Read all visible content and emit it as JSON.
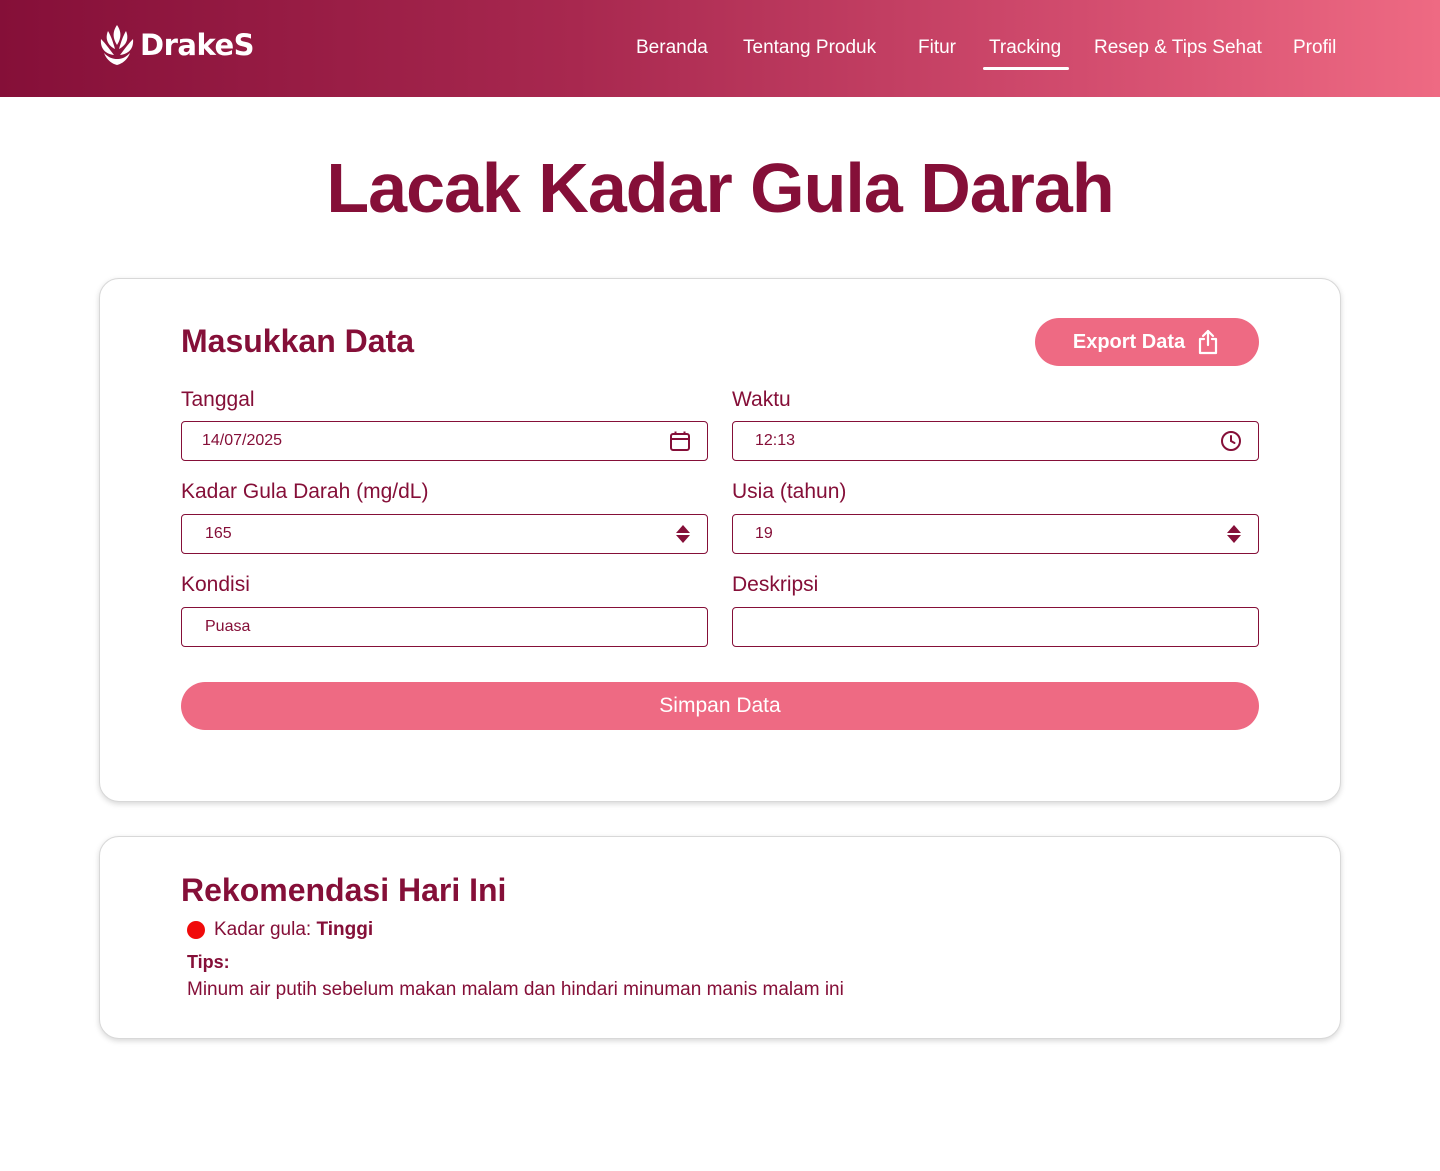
{
  "brand": {
    "name": "DrakeS",
    "logo_icon": "flame-leaf-logo"
  },
  "colors": {
    "primary": "#850f38",
    "accent": "#ee6a83",
    "status_high": "#f00a0a"
  },
  "nav": {
    "items": [
      {
        "label": "Beranda",
        "active": false
      },
      {
        "label": "Tentang Produk",
        "active": false
      },
      {
        "label": "Fitur",
        "active": false
      },
      {
        "label": "Tracking",
        "active": true
      },
      {
        "label": "Resep & Tips Sehat",
        "active": false
      },
      {
        "label": "Profil",
        "active": false
      }
    ]
  },
  "page": {
    "title": "Lacak Kadar Gula Darah"
  },
  "form": {
    "title": "Masukkan Data",
    "export_label": "Export Data",
    "export_icon": "share-export-icon",
    "fields": {
      "tanggal": {
        "label": "Tanggal",
        "value": "14/07/2025",
        "icon": "calendar-icon"
      },
      "waktu": {
        "label": "Waktu",
        "value": "12:13",
        "icon": "clock-icon"
      },
      "kadar": {
        "label": "Kadar Gula Darah (mg/dL)",
        "value": "165",
        "icon": "spinner-arrows-icon"
      },
      "usia": {
        "label": "Usia (tahun)",
        "value": "19",
        "icon": "spinner-arrows-icon"
      },
      "kondisi": {
        "label": "Kondisi",
        "value": "Puasa"
      },
      "deskripsi": {
        "label": "Deskripsi",
        "value": ""
      }
    },
    "save_label": "Simpan Data"
  },
  "recommendation": {
    "title": "Rekomendasi Hari Ini",
    "status_prefix": "Kadar gula: ",
    "status_value": "Tinggi",
    "tips_label": "Tips:",
    "tips_text": "Minum air putih sebelum makan malam dan hindari minuman manis malam ini"
  }
}
